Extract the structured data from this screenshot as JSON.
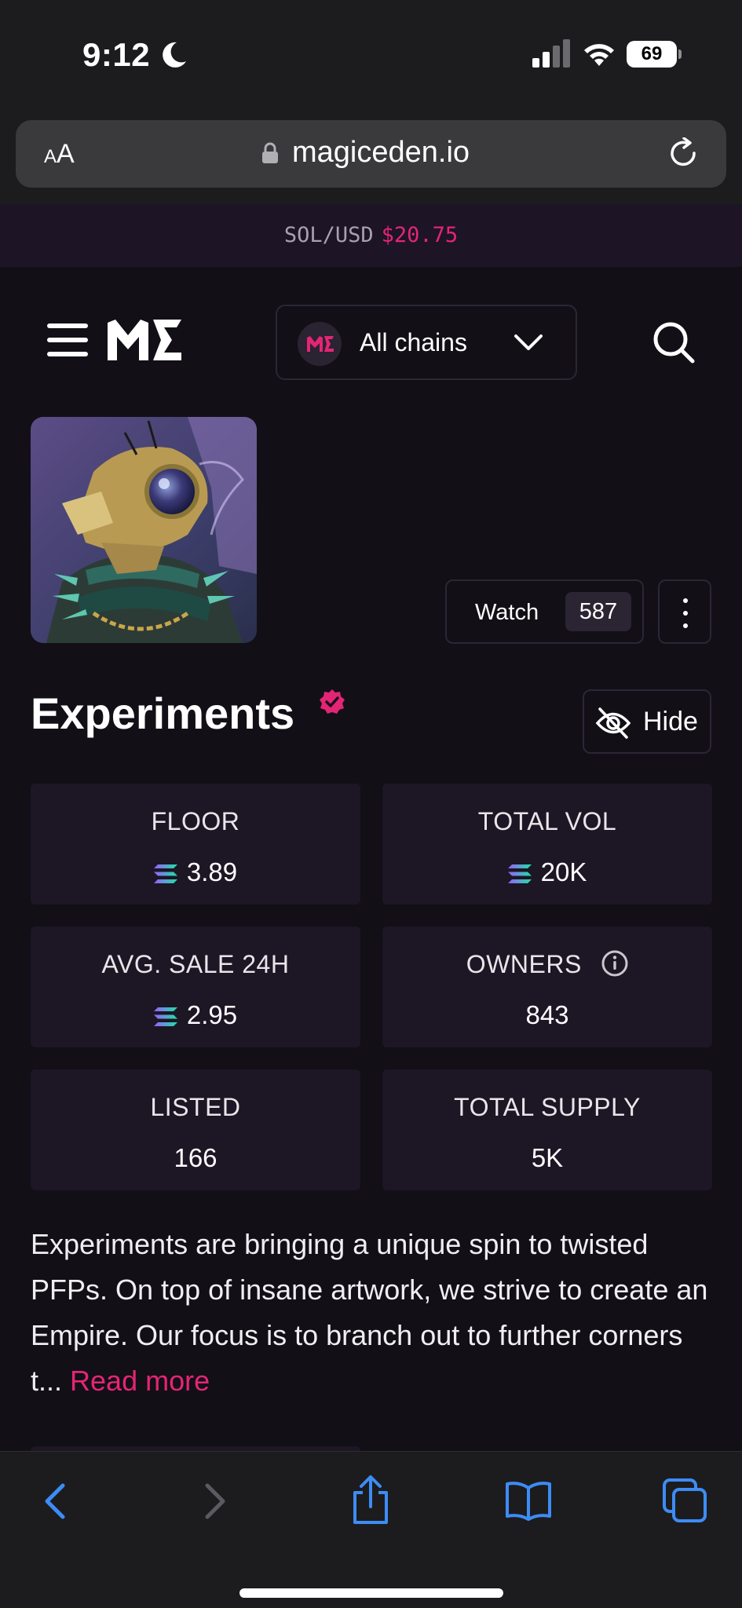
{
  "status": {
    "time": "9:12",
    "battery": "69"
  },
  "browser": {
    "text_size_small": "A",
    "text_size_large": "A",
    "url": "magiceden.io"
  },
  "ticker": {
    "label": "SOL/USD",
    "price": "$20.75"
  },
  "nav": {
    "chain_label": "All chains"
  },
  "collection": {
    "name": "Experiments",
    "watch_label": "Watch",
    "watch_count": "587",
    "hide_label": "Hide"
  },
  "stats": [
    {
      "label": "FLOOR",
      "value": "3.89"
    },
    {
      "label": "TOTAL VOL",
      "value": "20K"
    },
    {
      "label": "AVG. SALE 24H",
      "value": "2.95"
    },
    {
      "label": "OWNERS",
      "value": "843"
    },
    {
      "label": "LISTED",
      "value": "166"
    },
    {
      "label": "TOTAL SUPPLY",
      "value": "5K"
    }
  ],
  "description": {
    "text": "Experiments are bringing a unique spin to twisted PFPs. On top of insane artwork, we strive to create an Empire. Our focus is to branch out to further corners t...",
    "read_more": "Read more"
  },
  "colors": {
    "accent": "#e42575",
    "background": "#120f17",
    "card": "#1d1625",
    "ios_blue": "#3d8cf5"
  }
}
